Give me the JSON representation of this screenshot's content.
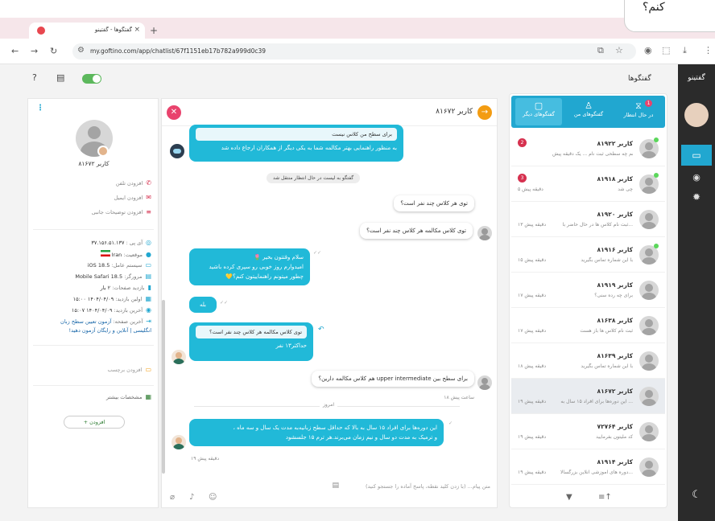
{
  "bubble_text": "کنم؟",
  "browser": {
    "tab_title": "گفتگوها - گفتینو",
    "tab_close": "×",
    "new_tab": "+",
    "url": "my.goftino.com/app/chatlist/67f1151eb17b782a999d0c39"
  },
  "app": {
    "brand": "گفتینو",
    "page_title": "گفتگوها"
  },
  "list": {
    "tabs": [
      {
        "label": "در حال انتظار",
        "count": "1"
      },
      {
        "label": "گفتگوهای من"
      },
      {
        "label": "گفتگوهای دیگر"
      }
    ],
    "items": [
      {
        "name": "کاربر ۸۱۹۲۲",
        "preview": "از کجا بدونم چه سطحی ثبت نام ... یک دقیقه پیش",
        "time": "",
        "badge": "2",
        "online": true
      },
      {
        "name": "کاربر ۸۱۹۱۸",
        "preview": "چی شد",
        "time": "۵ دقیقه پیش",
        "badge": "3",
        "online": true
      },
      {
        "name": "کاربر ۸۱۹۲۰",
        "preview": "ثبت نام کلاس ها در حال حاضر با...",
        "time": "۱۳ دقیقه پیش",
        "badge": "",
        "online": false
      },
      {
        "name": "کاربر ۸۱۹۱۶",
        "preview": "با این شماره تماس بگیرید",
        "time": "۱۵ دقیقه پیش",
        "badge": "",
        "online": true
      },
      {
        "name": "کاربر ۸۱۹۱۹",
        "preview": "برای چه رده سنی؟",
        "time": "۱۷ دقیقه پیش",
        "badge": "",
        "online": false
      },
      {
        "name": "کاربر ۸۱۶۳۸",
        "preview": "ثبت نام کلاس ها باز هست",
        "time": "۱۷ دقیقه پیش",
        "badge": "",
        "online": false
      },
      {
        "name": "کاربر ۸۱۶۳۹",
        "preview": "با این شماره تماس بگیرید",
        "time": "۱۸ دقیقه پیش",
        "badge": "",
        "online": false
      },
      {
        "name": "کاربر ۸۱۶۷۲",
        "preview": "این دوره‌ها برای افراد ۱۵ سال به ...",
        "time": "۱۹ دقیقه پیش",
        "badge": "",
        "online": false
      },
      {
        "name": "کاربر ۷۲۷۶۴",
        "preview": "کد ملیتون بفرمایید",
        "time": "۱۹ دقیقه پیش",
        "badge": "",
        "online": false
      },
      {
        "name": "کاربر ۸۱۹۱۴",
        "preview": "دوره های آموزشی آنلاین بزرگسالا...",
        "time": "۱۹ دقیقه پیش",
        "badge": "",
        "online": false
      }
    ]
  },
  "chat": {
    "user": "کاربر ۸۱۶۷۲",
    "m1_quote": "برای سطح من کلاس نیست",
    "m1_text": "به منظور راهنمایی بهتر مکالمه شما به یکی دیگر از همکاران ارجاع داده شد",
    "sys1": "گفتگو به لیست در حال انتظار منتقل شد",
    "v1": "توی هر کلاس چند نفر است؟",
    "v2": "توی کلاس مکالمه هر کلاس چند نفر است؟",
    "m2_l1": "سلام وقتتون بخیر 🌷",
    "m2_l2": "امیدوارم روز خوبی رو سپری کرده باشید",
    "m2_l3": "چطور میتونم راهنماییتون کنم؟💛",
    "m3": "بله",
    "m4_quote": "توی کلاس مکالمه هر کلاس چند نفر است؟",
    "m4_text": "حداکثر۱۳ نفر",
    "v3": "برای سطح بین upper intermediate هم کلاس مکالمه دارین؟",
    "v3_time": "۱۸ ساعت پیش",
    "day": "امروز",
    "m5_l1": "این دوره‌ها برای افراد ۱۵ سال به بالا که حداقل سطح زبانیه‌به مدت یک سال و سه ماه ،",
    "m5_l2": "و ترمیک به مدت دو سال و نیم زمان می‌برند.هر ترم ۱۵ جلسشود",
    "m5_time": "۱۹ دقیقه پیش",
    "placeholder": "متن پیام... (با زدن کلید نقطه، پاسخ آماده را جستجو کنید)"
  },
  "profile": {
    "name": "کاربر ۸۱۶۷۲",
    "add_phone": "افزودن تلفن",
    "add_email": "افزودن ایمیل",
    "add_desc": "افزودن توضیحات جانبی",
    "ip_label": "آی پی :",
    "ip": "۳۷.۱۵۶.۵۱.۱۳۷",
    "loc_label": "موقعیت:",
    "loc": "Iran",
    "os_label": "سیستم عامل:",
    "os": "iOS 18.5",
    "browser_label": "مرورگر:",
    "browser": "Mobile Safari 18.5",
    "views_label": "بازدید صفحات:",
    "views": "۲ بار",
    "first_label": "اولین بازدید:",
    "first": "۱۴۰۴/۰۴/۰۹ ۱۵:۰۰",
    "last_label": "آخرین بازدید:",
    "last": "۱۴۰۴/۰۴/۰۹ ۱۵:۰۷",
    "lastpage_label": "آخرین صفحه:",
    "lastpage_1": "آزمون تعیین سطح زبان",
    "lastpage_2": "انگلیسی | آنلاین و رایگان آزمون دهید!",
    "add_tag": "افزودن برچسب",
    "more_specs": "مشخصات بیشتر",
    "add_btn": "+ افزودن"
  }
}
